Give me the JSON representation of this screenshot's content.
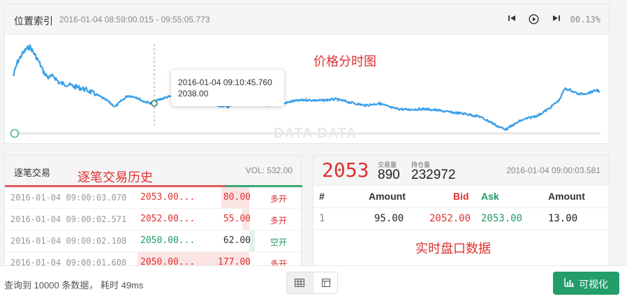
{
  "top": {
    "title": "位置索引",
    "time_range": "2016-01-04 08:59:00.015 - 09:55:05.773",
    "progress": "00.13%",
    "annotation": "价格分时图",
    "tooltip_time": "2016-01-04 09:10:45.760",
    "tooltip_value": "2038.00",
    "watermark": "DATA DATA",
    "line_color": "#3a9ee8"
  },
  "trades": {
    "title": "逐笔交易",
    "annotation": "逐笔交易历史",
    "vol": "VOL: 532.00",
    "rows": [
      {
        "time": "2016-01-04 09:00:03.070",
        "price": "2053.00...",
        "vol": "80.00",
        "type": "多开",
        "side": "red"
      },
      {
        "time": "2016-01-04 09:00:02.571",
        "price": "2052.00...",
        "vol": "55.00",
        "type": "多开",
        "side": "red"
      },
      {
        "time": "2016-01-04 09:00:02.108",
        "price": "2050.00...",
        "vol": "62.00",
        "type": "空开",
        "side": "green"
      },
      {
        "time": "2016-01-04 09:00:01.608",
        "price": "2050.00...",
        "vol": "177.00",
        "type": "多开",
        "side": "red"
      }
    ]
  },
  "book": {
    "last_price": "2053",
    "volume_label": "交易量",
    "volume": "890",
    "oi_label": "持仓量",
    "open_interest": "232972",
    "time": "2016-01-04 09:00:03.581",
    "headers": [
      "#",
      "Amount",
      "Bid",
      "Ask",
      "Amount"
    ],
    "row": {
      "index": "1",
      "bid_amount": "95.00",
      "bid": "2052.00",
      "ask": "2053.00",
      "ask_amount": "13.00"
    },
    "annotation": "实时盘口数据"
  },
  "footer": {
    "status": "查询到 10000 条数据， 耗时 49ms",
    "viz_label": "可视化"
  },
  "colors": {
    "accent_green": "#239d6a",
    "bid_red": "#e03030",
    "ask_green": "#1e9a63"
  }
}
